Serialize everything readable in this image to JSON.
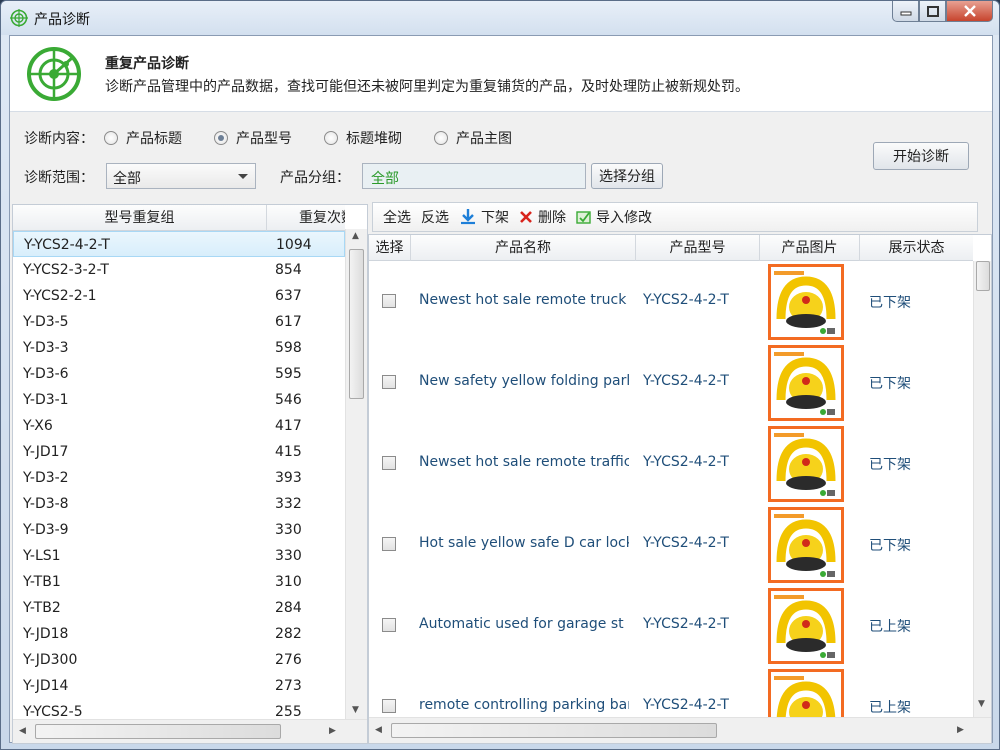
{
  "window": {
    "title": "产品诊断"
  },
  "header": {
    "title": "重复产品诊断",
    "description": "诊断产品管理中的产品数据，查找可能但还未被阿里判定为重复铺货的产品，及时处理防止被新规处罚。"
  },
  "filters": {
    "content_label": "诊断内容：",
    "content_options": [
      {
        "label": "产品标题",
        "selected": false
      },
      {
        "label": "产品型号",
        "selected": true
      },
      {
        "label": "标题堆砌",
        "selected": false
      },
      {
        "label": "产品主图",
        "selected": false
      }
    ],
    "scope_label": "诊断范围：",
    "scope_value": "全部",
    "group_label": "产品分组：",
    "group_value": "全部",
    "select_group_button": "选择分组",
    "start_button": "开始诊断"
  },
  "left_list": {
    "col_group": "型号重复组",
    "col_count": "重复次数",
    "rows": [
      {
        "name": "Y-YCS2-4-2-T",
        "count": "1094"
      },
      {
        "name": "Y-YCS2-3-2-T",
        "count": "854"
      },
      {
        "name": "Y-YCS2-2-1",
        "count": "637"
      },
      {
        "name": "Y-D3-5",
        "count": "617"
      },
      {
        "name": "Y-D3-3",
        "count": "598"
      },
      {
        "name": "Y-D3-6",
        "count": "595"
      },
      {
        "name": "Y-D3-1",
        "count": "546"
      },
      {
        "name": "Y-X6",
        "count": "417"
      },
      {
        "name": "Y-JD17",
        "count": "415"
      },
      {
        "name": "Y-D3-2",
        "count": "393"
      },
      {
        "name": "Y-D3-8",
        "count": "332"
      },
      {
        "name": "Y-D3-9",
        "count": "330"
      },
      {
        "name": "Y-LS1",
        "count": "330"
      },
      {
        "name": "Y-TB1",
        "count": "310"
      },
      {
        "name": "Y-TB2",
        "count": "284"
      },
      {
        "name": "Y-JD18",
        "count": "282"
      },
      {
        "name": "Y-JD300",
        "count": "276"
      },
      {
        "name": "Y-JD14",
        "count": "273"
      },
      {
        "name": "Y-YCS2-5",
        "count": "255"
      }
    ]
  },
  "toolbar": {
    "select_all": "全选",
    "invert": "反选",
    "delist": "下架",
    "delete": "删除",
    "import_edit": "导入修改"
  },
  "products": {
    "col_select": "选择",
    "col_name": "产品名称",
    "col_model": "产品型号",
    "col_image": "产品图片",
    "col_status": "展示状态",
    "rows": [
      {
        "name": "Newest hot sale remote truck",
        "model": "Y-YCS2-4-2-T",
        "status": "已下架"
      },
      {
        "name": "New safety yellow folding parking",
        "model": "Y-YCS2-4-2-T",
        "status": "已下架"
      },
      {
        "name": "Newset hot sale remote traffic",
        "model": "Y-YCS2-4-2-T",
        "status": "已下架"
      },
      {
        "name": "Hot sale yellow safe D car lock",
        "model": "Y-YCS2-4-2-T",
        "status": "已下架"
      },
      {
        "name": "Automatic used for garage st",
        "model": "Y-YCS2-4-2-T",
        "status": "已上架"
      },
      {
        "name": "remote controlling parking barrier",
        "model": "Y-YCS2-4-2-T",
        "status": "已上架"
      }
    ]
  },
  "colors": {
    "accent_green": "#3aaa35",
    "image_border": "#f36b22",
    "link_blue": "#1f4e79"
  }
}
